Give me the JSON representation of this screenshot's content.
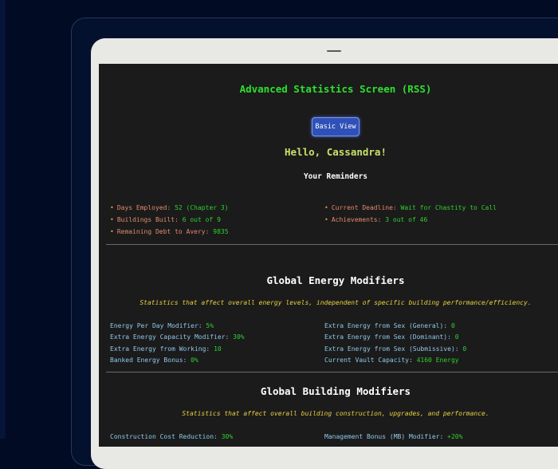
{
  "title": "Advanced Statistics Screen (RSS)",
  "basic_view_button": "Basic View",
  "greeting": "Hello, Cassandra!",
  "reminders": {
    "heading": "Your Reminders",
    "left": [
      {
        "label": "Days Employed:",
        "value": "52 (Chapter 3)"
      },
      {
        "label": "Buildings Built:",
        "value": "6 out of 9"
      },
      {
        "label": "Remaining Debt to Avery:",
        "value": "9835"
      }
    ],
    "right": [
      {
        "label": "Current Deadline:",
        "value": "Wait for Chastity to Call"
      },
      {
        "label": "Achievements:",
        "value": "3 out of 46"
      }
    ]
  },
  "energy": {
    "heading": "Global Energy Modifiers",
    "description": "Statistics that affect overall energy levels, independent of specific building performance/efficiency.",
    "left": [
      {
        "label": "Energy Per Day Modifier:",
        "value": "5%"
      },
      {
        "label": "Extra Energy Capacity Modifier:",
        "value": "30%"
      },
      {
        "label": "Extra Energy from Working:",
        "value": "10"
      },
      {
        "label": "Banked Energy Bonus:",
        "value": "0%"
      }
    ],
    "right": [
      {
        "label": "Extra Energy from Sex (General):",
        "value": "0"
      },
      {
        "label": "Extra Energy from Sex (Dominant):",
        "value": "0"
      },
      {
        "label": "Extra Energy from Sex (Submissive):",
        "value": "0"
      },
      {
        "label": "Current Vault Capacity:",
        "value": "4160 Energy"
      }
    ]
  },
  "building": {
    "heading": "Global Building Modifiers",
    "description": "Statistics that affect overall building construction, upgrades, and performance.",
    "left": [
      {
        "label": "Construction Cost Reduction:",
        "value": "30%"
      }
    ],
    "right": [
      {
        "label": "Management Bonus (MB) Modifier:",
        "value": "+20%"
      }
    ]
  },
  "colors": {
    "background": "#020b24",
    "screen": "#1b1b1b",
    "title_green": "#2ee02e",
    "button_blue": "#2f51b7",
    "greeting_yellow": "#c8e06a",
    "reminder_label": "#e28a6a",
    "stat_label": "#8fc8ea",
    "description_yellow": "#e8d040"
  }
}
